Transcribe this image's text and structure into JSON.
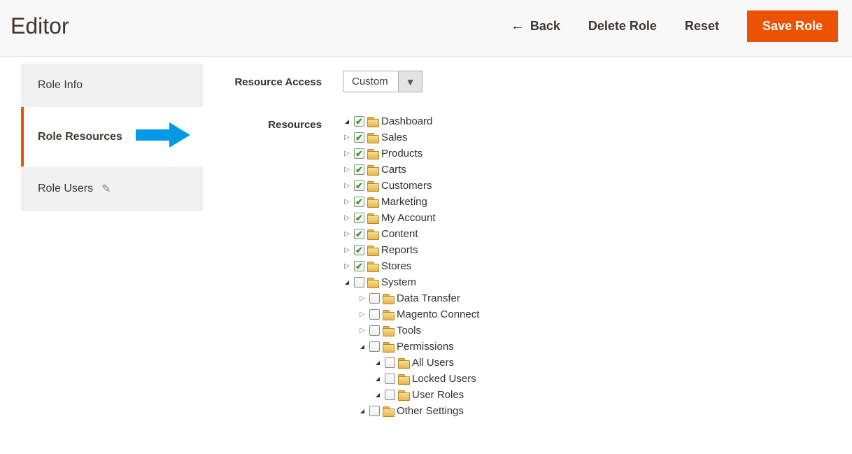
{
  "header": {
    "title": "Editor",
    "actions": {
      "back": "Back",
      "delete": "Delete Role",
      "reset": "Reset",
      "save": "Save Role"
    }
  },
  "sidebar": {
    "tabs": [
      {
        "label": "Role Info"
      },
      {
        "label": "Role Resources"
      },
      {
        "label": "Role Users"
      }
    ]
  },
  "main": {
    "resource_access_label": "Resource Access",
    "resource_access_value": "Custom",
    "resources_label": "Resources",
    "tree": [
      {
        "label": "Dashboard",
        "checked": true,
        "expander": "down",
        "depth": 0
      },
      {
        "label": "Sales",
        "checked": true,
        "expander": "right",
        "depth": 0
      },
      {
        "label": "Products",
        "checked": true,
        "expander": "right",
        "depth": 0
      },
      {
        "label": "Carts",
        "checked": true,
        "expander": "right",
        "depth": 0
      },
      {
        "label": "Customers",
        "checked": true,
        "expander": "right",
        "depth": 0
      },
      {
        "label": "Marketing",
        "checked": true,
        "expander": "right",
        "depth": 0
      },
      {
        "label": "My Account",
        "checked": true,
        "expander": "right",
        "depth": 0
      },
      {
        "label": "Content",
        "checked": true,
        "expander": "right",
        "depth": 0
      },
      {
        "label": "Reports",
        "checked": true,
        "expander": "right",
        "depth": 0
      },
      {
        "label": "Stores",
        "checked": true,
        "expander": "right",
        "depth": 0
      },
      {
        "label": "System",
        "checked": false,
        "expander": "down",
        "depth": 0
      },
      {
        "label": "Data Transfer",
        "checked": false,
        "expander": "right",
        "depth": 1
      },
      {
        "label": "Magento Connect",
        "checked": false,
        "expander": "right",
        "depth": 1
      },
      {
        "label": "Tools",
        "checked": false,
        "expander": "right",
        "depth": 1
      },
      {
        "label": "Permissions",
        "checked": false,
        "expander": "down",
        "depth": 1
      },
      {
        "label": "All Users",
        "checked": false,
        "expander": "down",
        "depth": 2
      },
      {
        "label": "Locked Users",
        "checked": false,
        "expander": "down",
        "depth": 2
      },
      {
        "label": "User Roles",
        "checked": false,
        "expander": "down",
        "depth": 2
      },
      {
        "label": "Other Settings",
        "checked": false,
        "expander": "down",
        "depth": 1
      }
    ]
  }
}
